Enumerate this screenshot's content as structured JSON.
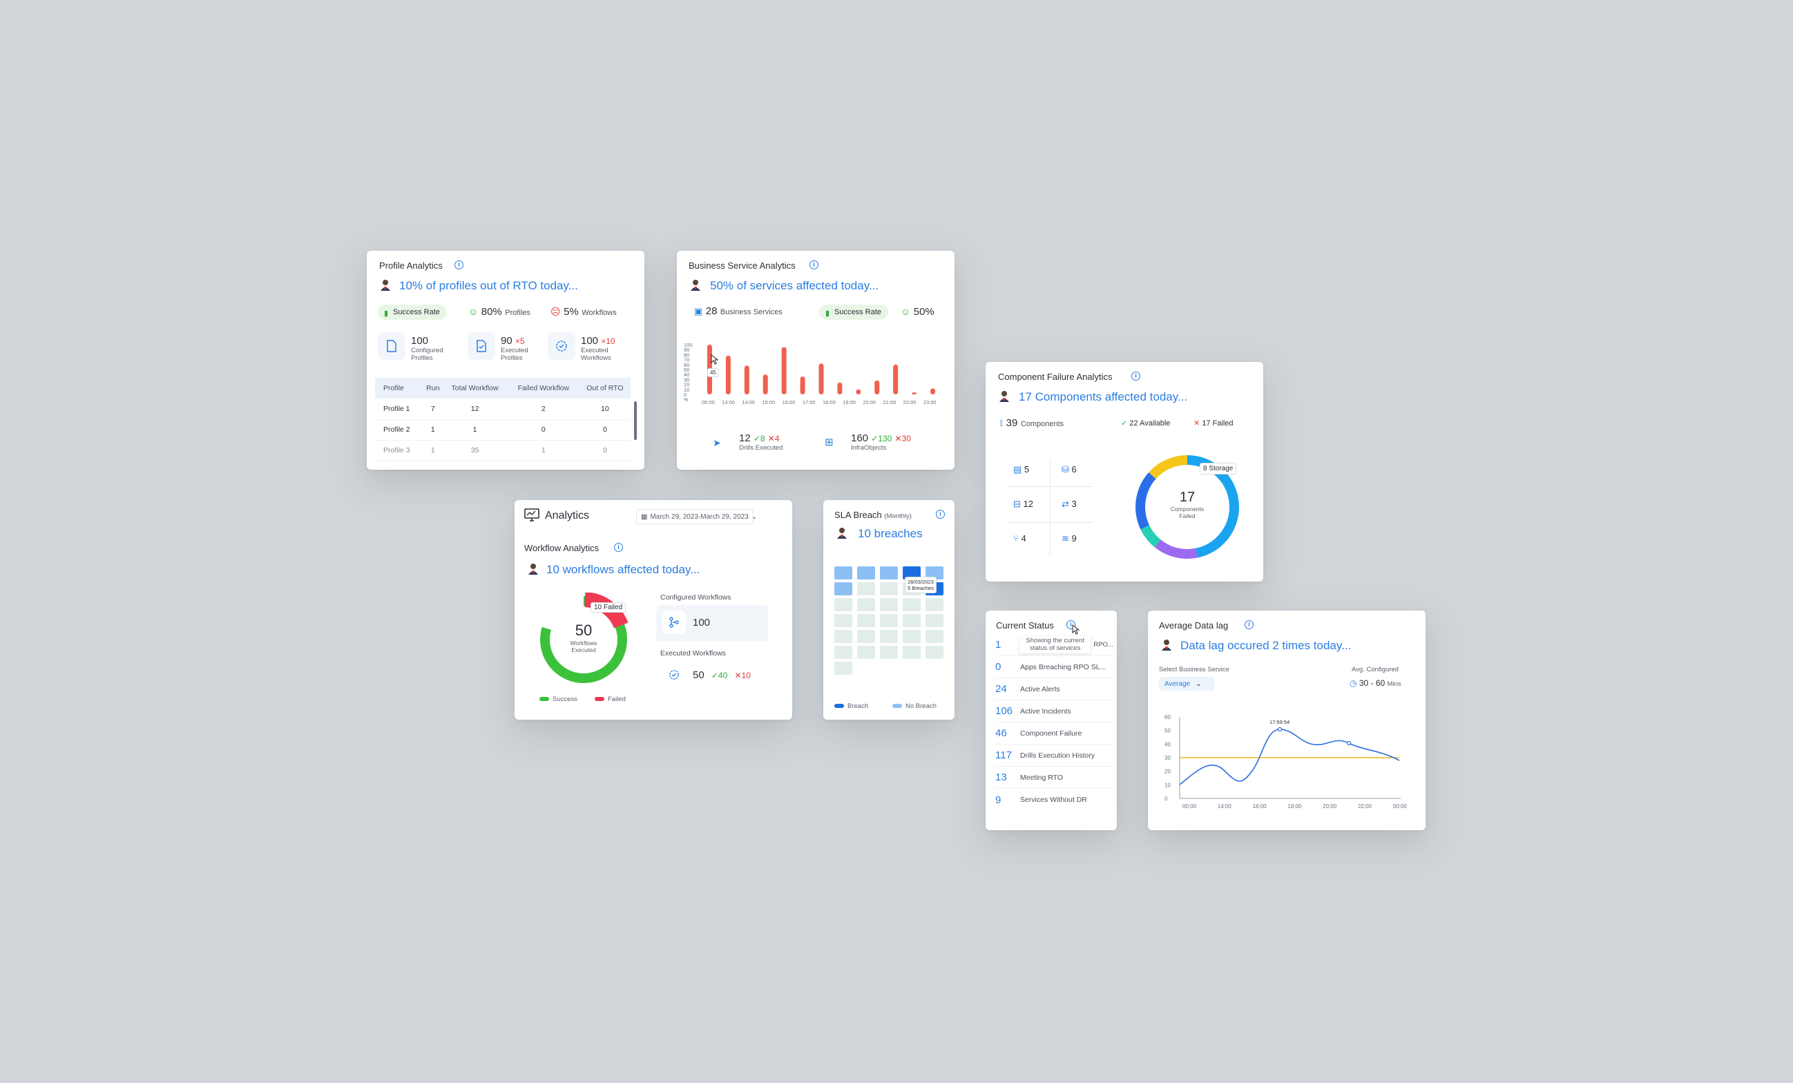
{
  "profile_analytics": {
    "title": "Profile Analytics",
    "headline": "10% of profiles out of RTO today...",
    "success_rate_label": "Success Rate",
    "profiles_pct": "80%",
    "profiles_label": "Profiles",
    "workflows_pct": "5%",
    "workflows_label": "Workflows",
    "stats": [
      {
        "value": "100",
        "label1": "Configured",
        "label2": "Profiles",
        "fail": ""
      },
      {
        "value": "90",
        "label1": "Executed",
        "label2": "Profiles",
        "fail": "×5"
      },
      {
        "value": "100",
        "label1": "Executed",
        "label2": "Workflows",
        "fail": "×10"
      }
    ],
    "table": {
      "headers": [
        "Profile",
        "Run",
        "Total Workflow",
        "Failed Workflow",
        "Out of RTO"
      ],
      "rows": [
        [
          "Profile 1",
          "7",
          "12",
          "2",
          "10"
        ],
        [
          "Profile 2",
          "1",
          "1",
          "0",
          "0"
        ],
        [
          "Profile 3",
          "1",
          "35",
          "1",
          "0"
        ]
      ]
    }
  },
  "business_service": {
    "title": "Business Service Analytics",
    "headline": "50% of services affected today...",
    "count": "28",
    "count_label": "Business Services",
    "success_rate_label": "Success Rate",
    "success_pct": "50%",
    "tooltip": "45",
    "drills": {
      "value": "12",
      "ok": "8",
      "fail": "4",
      "label": "Drills Executed"
    },
    "infra": {
      "value": "160",
      "ok": "130",
      "fail": "30",
      "label": "InfraObjects"
    }
  },
  "chart_data": {
    "type": "bar",
    "title": "",
    "xlabel": "",
    "ylabel": "%",
    "ylim": [
      0,
      100
    ],
    "yticks": [
      "100",
      "90",
      "80",
      "70",
      "60",
      "50",
      "40",
      "30",
      "20",
      "10",
      "0",
      "%"
    ],
    "categories": [
      "00:00",
      "13:00",
      "14:00",
      "15:00",
      "16:00",
      "17:00",
      "18:00",
      "19:00",
      "20:00",
      "21:00",
      "22:00",
      "23:00"
    ],
    "values": [
      100,
      78,
      58,
      40,
      95,
      36,
      62,
      24,
      10,
      28,
      60,
      4,
      12
    ],
    "bar_color": "#f0604f"
  },
  "component_failure": {
    "title": "Component Failure Analytics",
    "headline": "17 Components affected today...",
    "components": "39",
    "components_label": "Components",
    "available": "22 Available",
    "failed": "17 Failed",
    "grid": [
      {
        "icon": "book-icon",
        "value": "5"
      },
      {
        "icon": "database-icon",
        "value": "6"
      },
      {
        "icon": "drive-icon",
        "value": "12"
      },
      {
        "icon": "sync-icon",
        "value": "3"
      },
      {
        "icon": "branch-icon",
        "value": "4"
      },
      {
        "icon": "layers-icon",
        "value": "9"
      }
    ],
    "donut_value": "17",
    "donut_label1": "Components",
    "donut_label2": "Failed",
    "donut_tooltip": "8 Storage"
  },
  "analytics": {
    "title": "Analytics",
    "date_range": "March 29, 2023-March 29, 2023",
    "subtitle": "Workflow Analytics",
    "headline": "10 workflows affected today...",
    "donut_value": "50",
    "donut_label1": "Workflows",
    "donut_label2": "Executed",
    "failed_tag": "10 Failed",
    "configured_label": "Configured Workflows",
    "configured_value": "100",
    "executed_label": "Executed Workflows",
    "executed_value": "50",
    "executed_ok": "40",
    "executed_fail": "10",
    "legend_success": "Success",
    "legend_failed": "Failed"
  },
  "sla_breach": {
    "title": "SLA Breach",
    "period": "(Monthly)",
    "headline": "10 breaches",
    "tooltip_date": "28/03/2023",
    "tooltip_text": "5 Breaches",
    "legend_breach": "Breach",
    "legend_no_breach": "No Breach"
  },
  "current_status": {
    "title": "Current Status",
    "items": [
      {
        "num": "1",
        "label": "Showing the current status of services",
        "suffix": "RPO..."
      },
      {
        "num": "0",
        "label": "Apps Breaching RPO SL..."
      },
      {
        "num": "24",
        "label": "Active Alerts"
      },
      {
        "num": "106",
        "label": "Active Incidents"
      },
      {
        "num": "46",
        "label": "Component Failure"
      },
      {
        "num": "117",
        "label": "Drills Execution History"
      },
      {
        "num": "13",
        "label": "Meeting RTO"
      },
      {
        "num": "9",
        "label": "Services Without DR"
      }
    ]
  },
  "data_lag": {
    "title": "Average Data lag",
    "headline": "Data lag occured 2 times today...",
    "select_label": "Select Business Service",
    "select_value": "Average",
    "avg_label": "Avg. Configured",
    "avg_value": "30 - 60",
    "avg_unit": "Mins",
    "tooltip": "17:59:54",
    "yticks": [
      "60",
      "50",
      "40",
      "30",
      "20",
      "10",
      "0"
    ],
    "xticks": [
      "00:00",
      "14:00",
      "16:00",
      "18:00",
      "20:00",
      "22:00",
      "00:00"
    ]
  }
}
